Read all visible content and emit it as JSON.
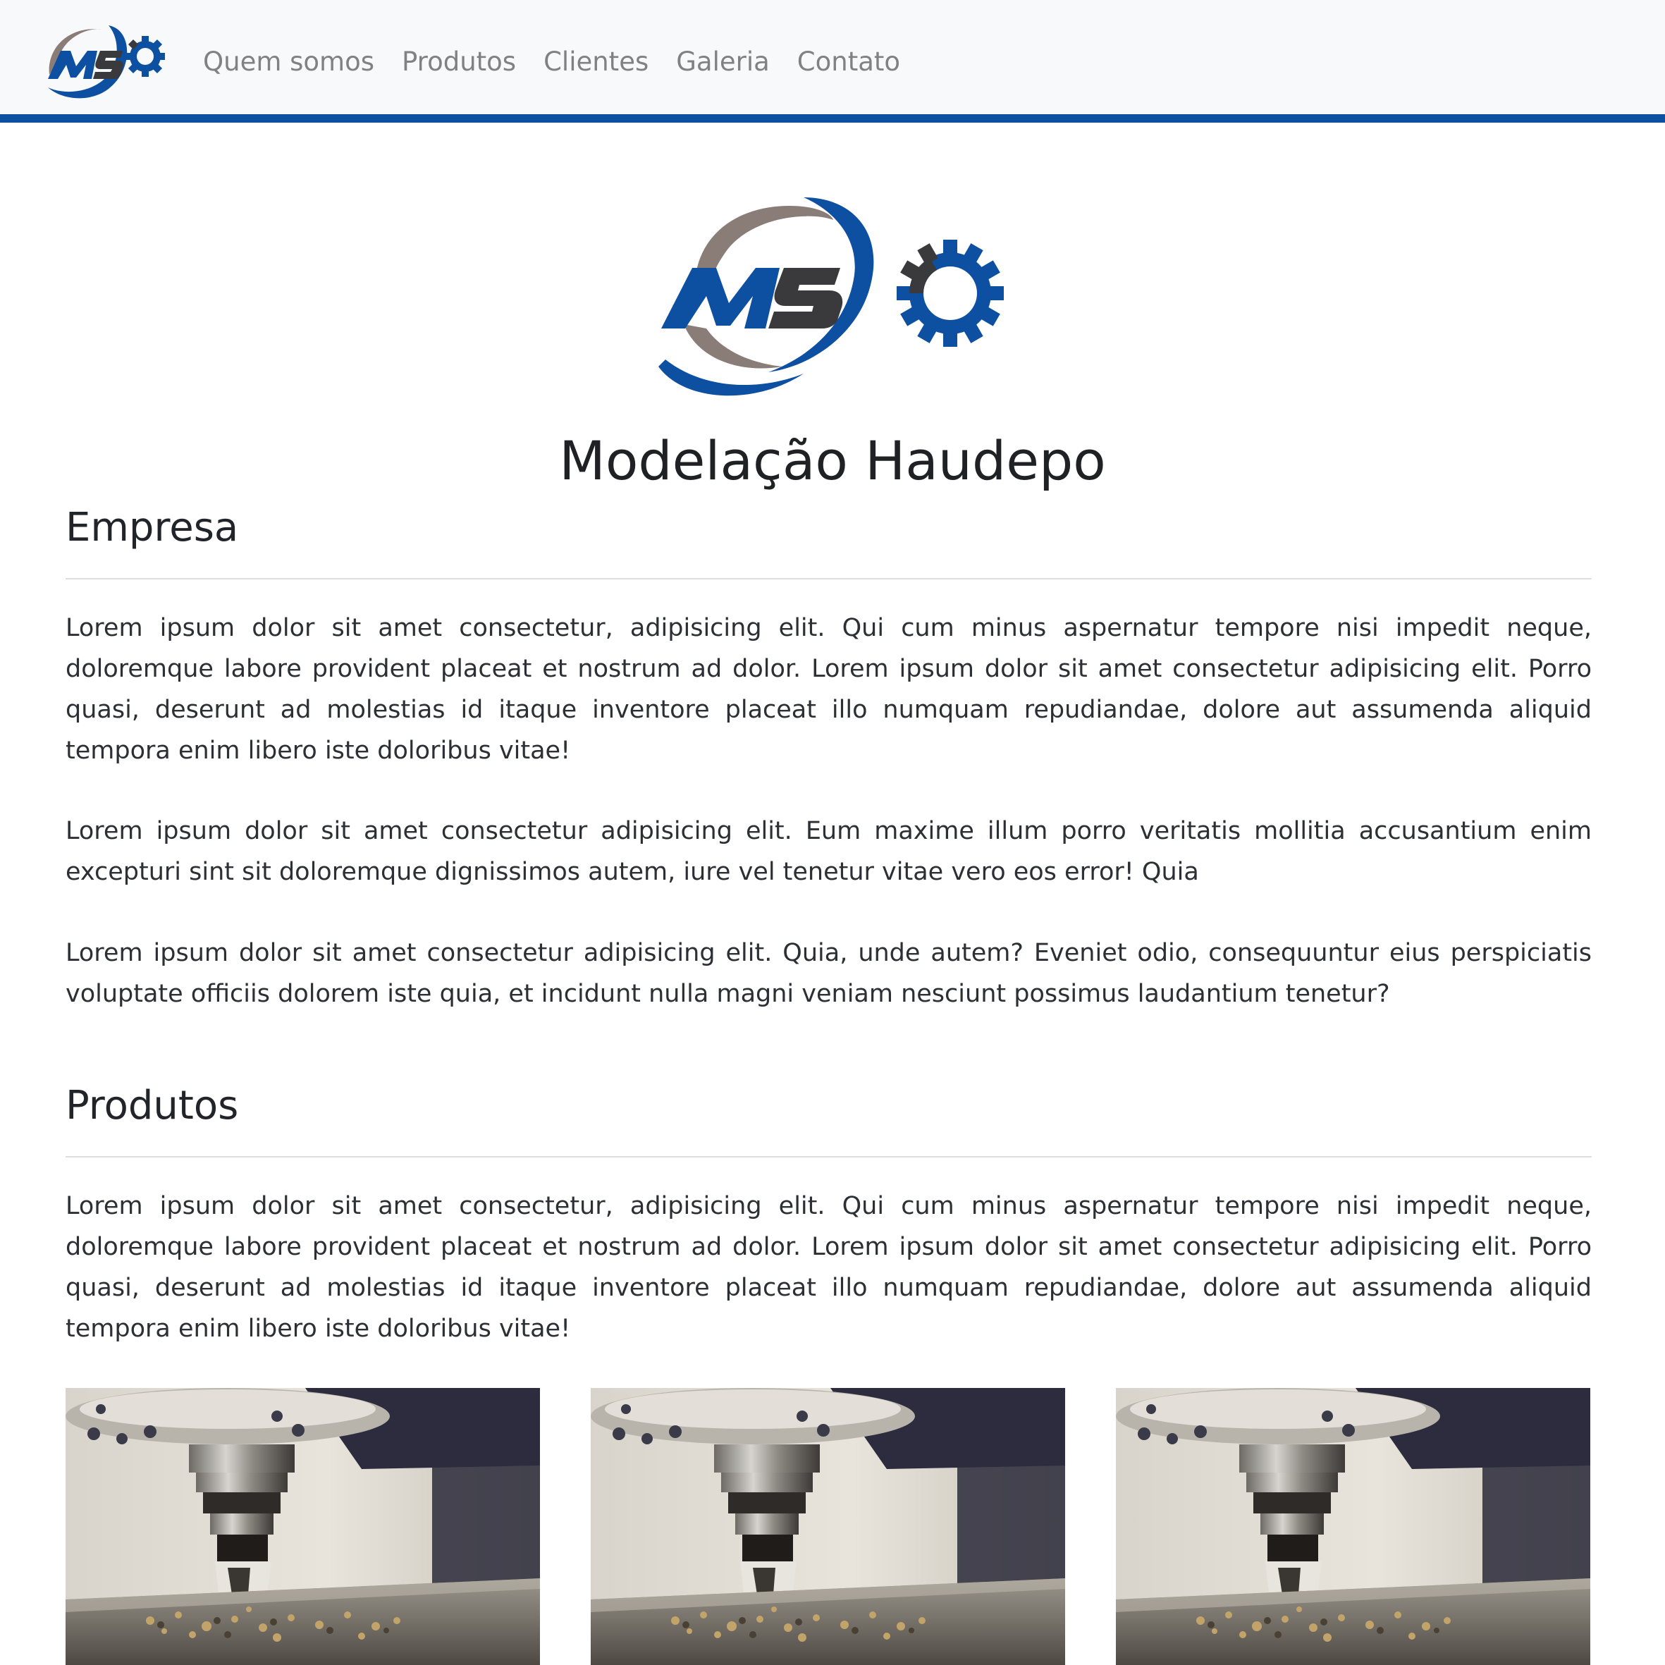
{
  "nav": {
    "logo_text": "MSO",
    "links": [
      {
        "label": "Quem somos"
      },
      {
        "label": "Produtos"
      },
      {
        "label": "Clientes"
      },
      {
        "label": "Galeria"
      },
      {
        "label": "Contato"
      }
    ]
  },
  "hero": {
    "logo_text": "MSO",
    "title": "Modelação Haudepo"
  },
  "sections": {
    "empresa": {
      "heading": "Empresa",
      "paragraphs": [
        "Lorem ipsum dolor sit amet consectetur, adipisicing elit. Qui cum minus aspernatur tempore nisi impedit neque, doloremque labore provident placeat et nostrum ad dolor. Lorem ipsum dolor sit amet consectetur adipisicing elit. Porro quasi, deserunt ad molestias id itaque inventore placeat illo numquam repudiandae, dolore aut assumenda aliquid tempora enim libero iste doloribus vitae!",
        "Lorem ipsum dolor sit amet consectetur adipisicing elit. Eum maxime illum porro veritatis mollitia accusantium enim excepturi sint sit doloremque dignissimos autem, iure vel tenetur vitae vero eos error! Quia",
        "Lorem ipsum dolor sit amet consectetur adipisicing elit. Quia, unde autem? Eveniet odio, consequuntur eius perspiciatis voluptate officiis dolorem iste quia, et incidunt nulla magni veniam nesciunt possimus laudantium tenetur?"
      ]
    },
    "produtos": {
      "heading": "Produtos",
      "paragraphs": [
        "Lorem ipsum dolor sit amet consectetur, adipisicing elit. Qui cum minus aspernatur tempore nisi impedit neque, doloremque labore provident placeat et nostrum ad dolor. Lorem ipsum dolor sit amet consectetur adipisicing elit. Porro quasi, deserunt ad molestias id itaque inventore placeat illo numquam repudiandae, dolore aut assumenda aliquid tempora enim libero iste doloribus vitae!"
      ],
      "images": [
        {
          "subject": "cnc-milling-machine"
        },
        {
          "subject": "cnc-milling-machine"
        },
        {
          "subject": "cnc-milling-machine"
        }
      ]
    }
  },
  "colors": {
    "brand_blue": "#0d4fa0",
    "logo_gray": "#3a3a3c",
    "logo_taupe": "#8a7d78",
    "navbar_bg": "#f8f9fa",
    "nav_link": "#808183"
  }
}
